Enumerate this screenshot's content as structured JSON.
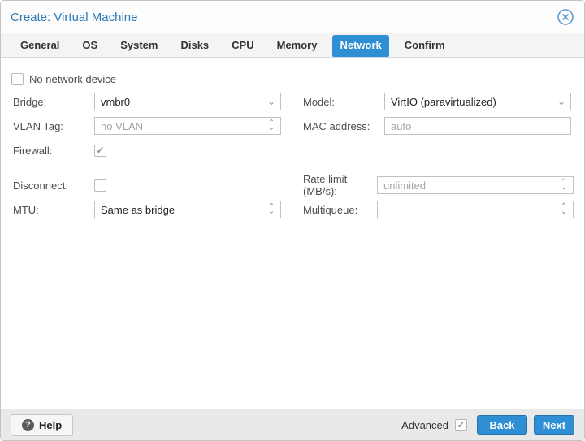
{
  "window": {
    "title": "Create: Virtual Machine"
  },
  "tabs": [
    {
      "label": "General",
      "active": false
    },
    {
      "label": "OS",
      "active": false
    },
    {
      "label": "System",
      "active": false
    },
    {
      "label": "Disks",
      "active": false
    },
    {
      "label": "CPU",
      "active": false
    },
    {
      "label": "Memory",
      "active": false
    },
    {
      "label": "Network",
      "active": true
    },
    {
      "label": "Confirm",
      "active": false
    }
  ],
  "form": {
    "no_network_device": {
      "label": "No network device",
      "checked": false,
      "checkmark": ""
    },
    "bridge": {
      "label": "Bridge:",
      "value": "vmbr0"
    },
    "model": {
      "label": "Model:",
      "value": "VirtIO (paravirtualized)"
    },
    "vlan_tag": {
      "label": "VLAN Tag:",
      "placeholder": "no VLAN"
    },
    "mac_address": {
      "label": "MAC address:",
      "placeholder": "auto"
    },
    "firewall": {
      "label": "Firewall:",
      "checked": true,
      "checkmark": "✓"
    },
    "disconnect": {
      "label": "Disconnect:",
      "checked": false,
      "checkmark": ""
    },
    "rate_limit": {
      "label": "Rate limit (MB/s):",
      "placeholder": "unlimited"
    },
    "mtu": {
      "label": "MTU:",
      "value": "Same as bridge"
    },
    "multiqueue": {
      "label": "Multiqueue:",
      "value": ""
    }
  },
  "footer": {
    "help_label": "Help",
    "help_glyph": "?",
    "advanced_label": "Advanced",
    "advanced_checked": true,
    "advanced_checkmark": "✓",
    "back_label": "Back",
    "next_label": "Next"
  },
  "icons": {
    "chevron_down": "⌄",
    "chevron_up": "⌃"
  },
  "colors": {
    "accent": "#2e8fd5",
    "title_blue": "#2a7ab9",
    "footer_bg": "#e9e9e9"
  }
}
